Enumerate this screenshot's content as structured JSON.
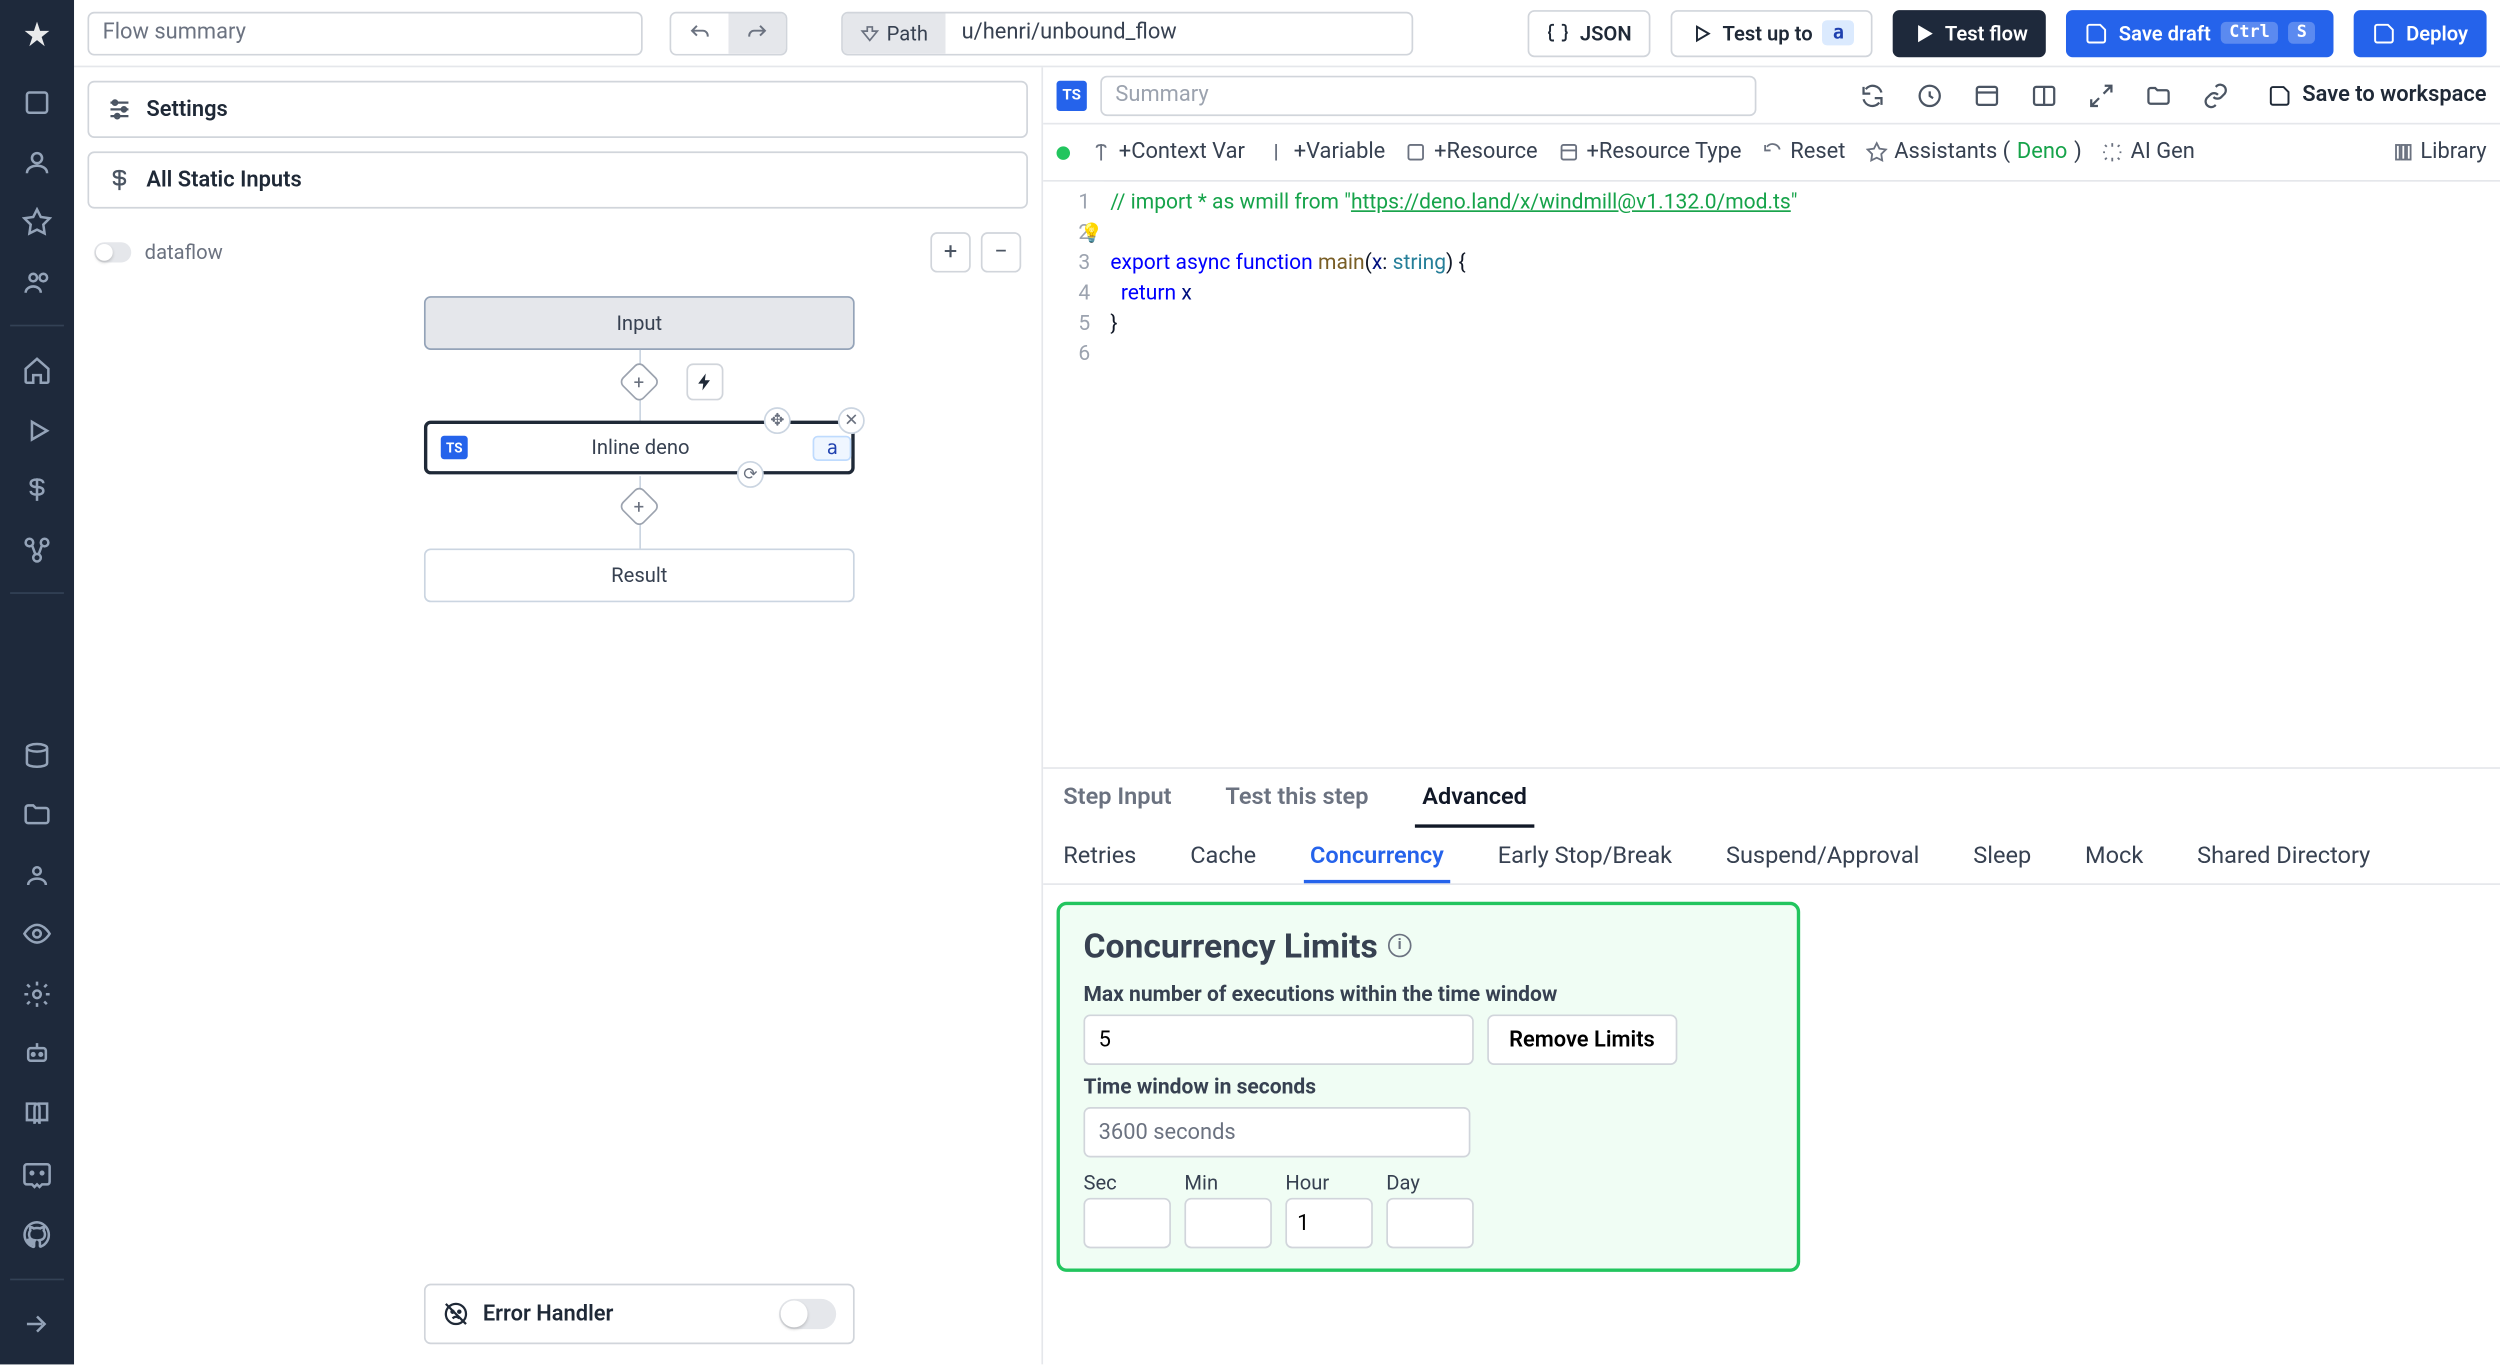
{
  "topbar": {
    "flow_summary_placeholder": "Flow summary",
    "path_label": "Path",
    "path_value": "u/henri/unbound_flow",
    "json_btn": "JSON",
    "test_up_to": "Test up to",
    "test_up_to_tag": "a",
    "test_flow": "Test flow",
    "save_draft": "Save draft",
    "save_draft_k1": "Ctrl",
    "save_draft_k2": "S",
    "deploy": "Deploy"
  },
  "left": {
    "settings": "Settings",
    "all_static": "All Static Inputs",
    "dataflow": "dataflow",
    "nodes": {
      "input": "Input",
      "step_title": "Inline deno",
      "step_tag": "a",
      "result": "Result"
    },
    "error_handler": "Error Handler"
  },
  "editor": {
    "summary_placeholder": "Summary",
    "save_ws": "Save to workspace",
    "tools": {
      "context_var": "+Context Var",
      "variable": "+Variable",
      "resource": "+Resource",
      "resource_type": "+Resource Type",
      "reset": "Reset",
      "assistants": "Assistants (",
      "assistants_lang": "Deno",
      "assistants_close": ")",
      "ai_gen": "AI Gen",
      "library": "Library"
    },
    "code": {
      "l1a": "// import * as wmill from \"",
      "l1b": "https://deno.land/x/windmill@v1.132.0/mod.ts",
      "l1c": "\"",
      "l3_export": "export",
      "l3_async": "async",
      "l3_function": "function",
      "l3_main": "main",
      "l3_x": "x",
      "l3_string": "string",
      "l4_return": "return",
      "l4_x": "x",
      "l5": "}"
    }
  },
  "step_tabs": {
    "t1": "Step Input",
    "t2": "Test this step",
    "t3": "Advanced"
  },
  "sub_tabs": {
    "t1": "Retries",
    "t2": "Cache",
    "t3": "Concurrency",
    "t4": "Early Stop/Break",
    "t5": "Suspend/Approval",
    "t6": "Sleep",
    "t7": "Mock",
    "t8": "Shared Directory"
  },
  "panel": {
    "title": "Concurrency Limits",
    "max_label": "Max number of executions within the time window",
    "max_value": "5",
    "remove": "Remove Limits",
    "window_label": "Time window in seconds",
    "window_value": "3600 seconds",
    "sec": "Sec",
    "min": "Min",
    "hour": "Hour",
    "day": "Day",
    "hour_value": "1"
  }
}
